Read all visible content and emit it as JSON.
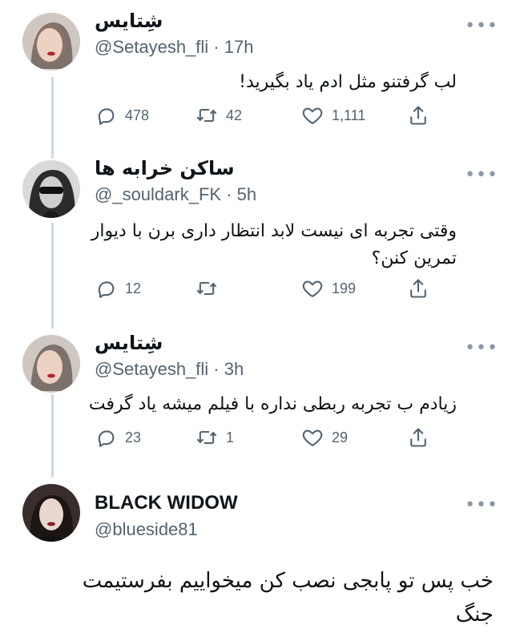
{
  "tweets": [
    {
      "name": "شِتایس",
      "handle": "@Setayesh_fli",
      "time": "17h",
      "text": "لب گرفتنو مثل ادم یاد بگیرید!",
      "replies": "478",
      "retweets": "42",
      "likes": "1,111"
    },
    {
      "name": "ساکن خرابه ها",
      "handle": "@_souldark_FK",
      "time": "5h",
      "text": "وقتی تجربه ای نیست لابد انتظار داری برن با دیوار تمرین کنن؟",
      "replies": "12",
      "retweets": "",
      "likes": "199"
    },
    {
      "name": "شِتایس",
      "handle": "@Setayesh_fli",
      "time": "3h",
      "text": "زیادم ب تجربه ربطی نداره با فیلم میشه یاد گرفت",
      "replies": "23",
      "retweets": "1",
      "likes": "29"
    },
    {
      "name": "BLACK WIDOW",
      "handle": "@blueside81",
      "time": "",
      "text": "خب پس تو پابجی نصب کن میخواییم بفرستیمت جنگ"
    }
  ],
  "icons": {
    "reply": "reply-icon",
    "retweet": "retweet-icon",
    "like": "heart-icon",
    "share": "share-icon",
    "more": "more-options-icon"
  },
  "colors": {
    "text": "#0f1419",
    "secondary": "#536471",
    "thread_line": "#cfd9de"
  }
}
